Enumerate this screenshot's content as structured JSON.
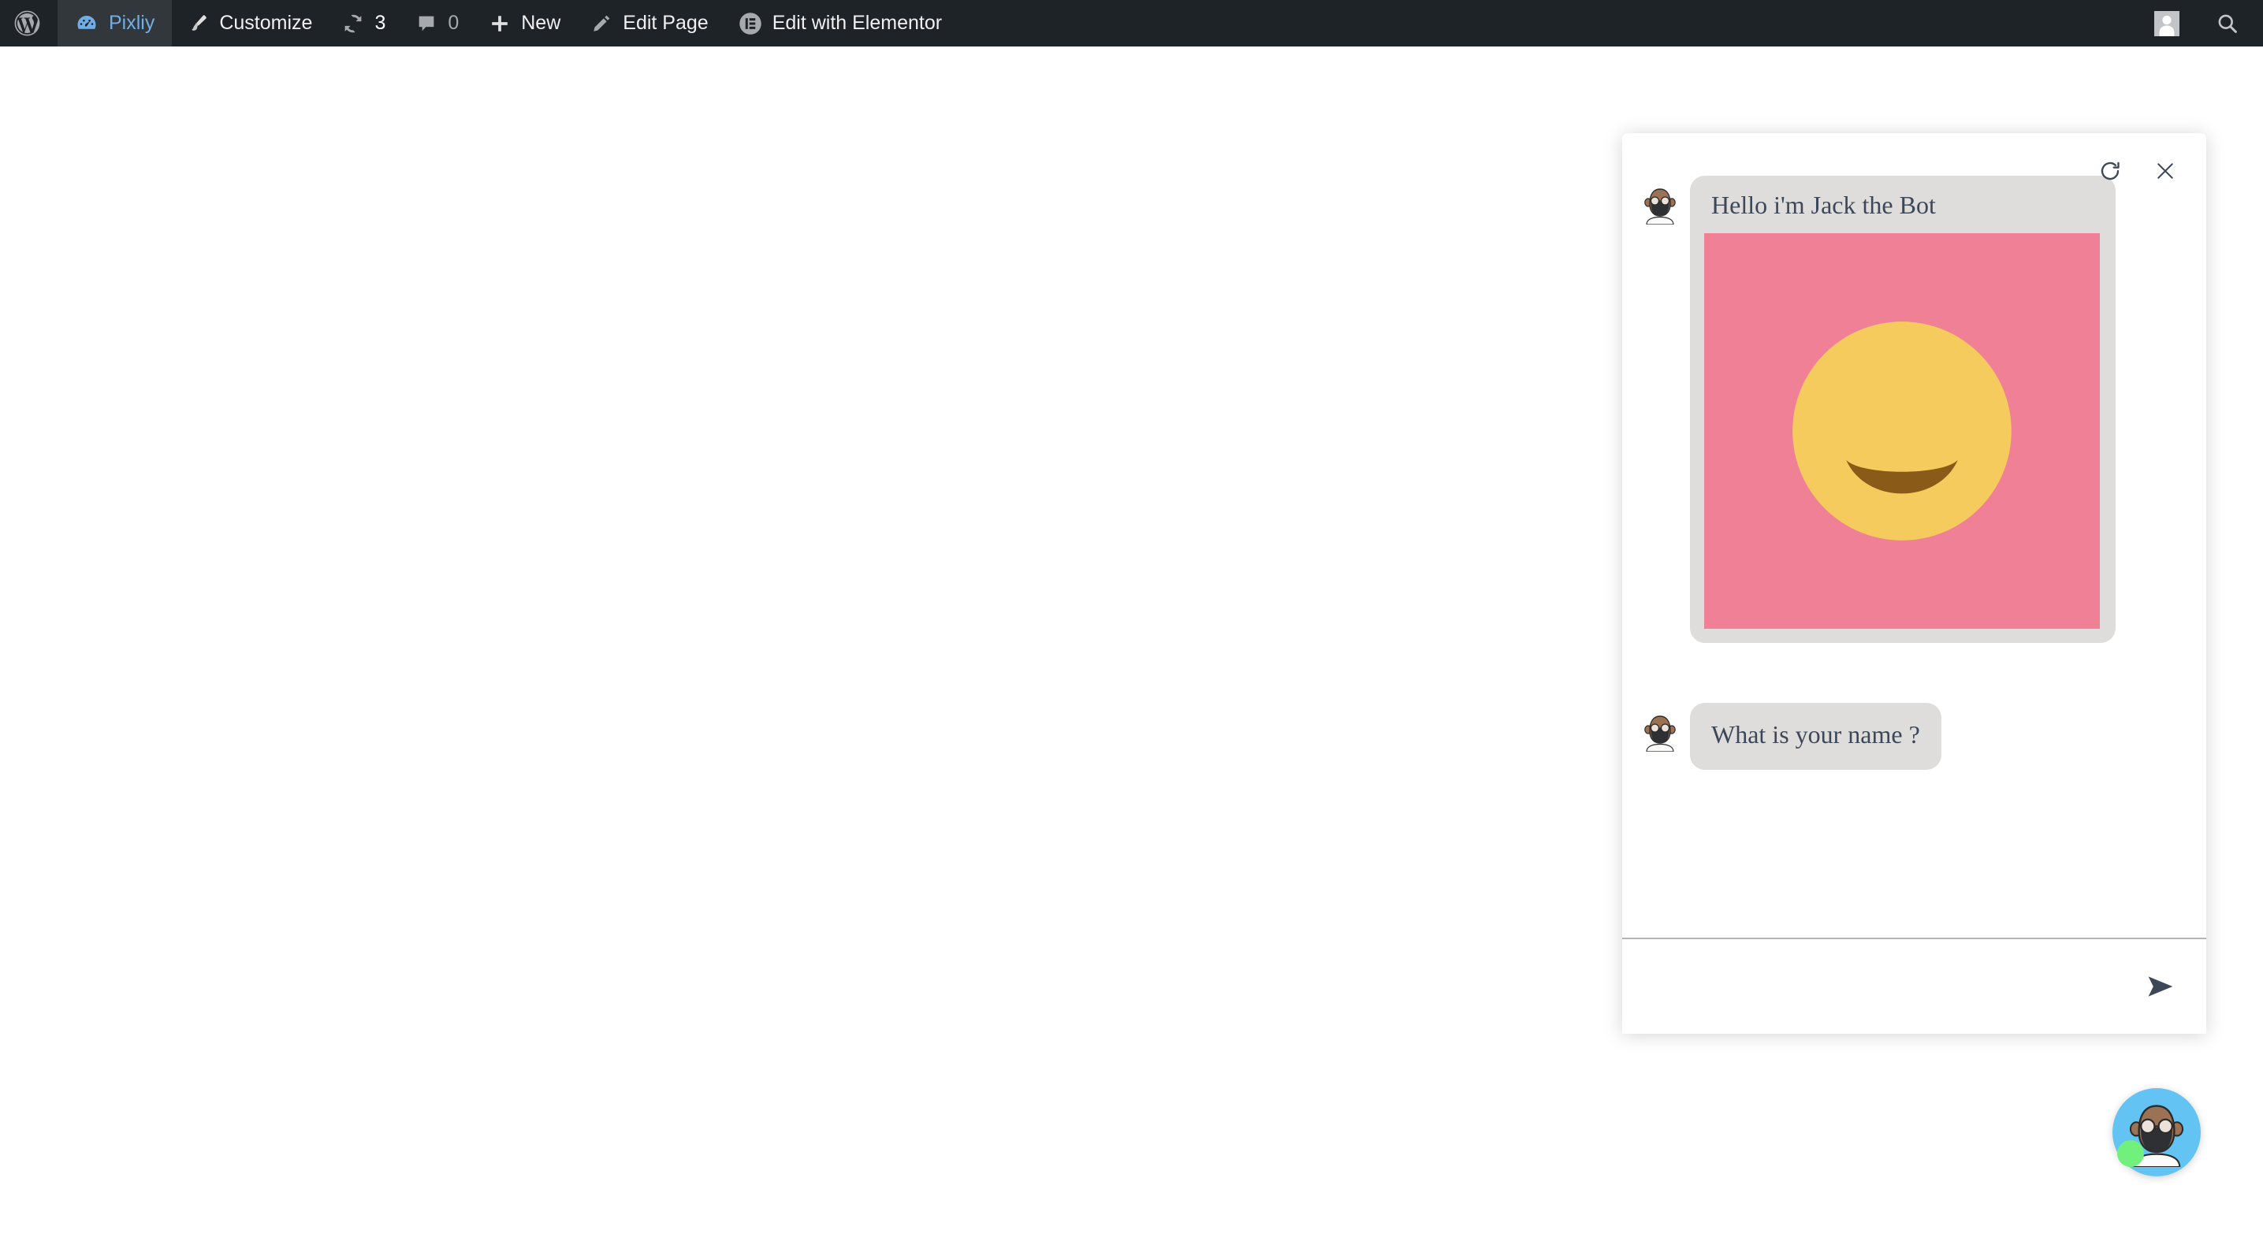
{
  "adminbar": {
    "wp_logo": "wordpress-logo-icon",
    "site_name": "Pixliy",
    "site_icon": "dashboard-speedometer-icon",
    "customize": {
      "label": "Customize",
      "icon": "paintbrush-icon"
    },
    "updates": {
      "count": "3",
      "icon": "update-refresh-icon"
    },
    "comments": {
      "count": "0",
      "icon": "comment-bubble-icon"
    },
    "new": {
      "label": "New",
      "icon": "plus-icon"
    },
    "edit_page": {
      "label": "Edit Page",
      "icon": "pencil-icon"
    },
    "elementor": {
      "label": "Edit with Elementor",
      "icon": "elementor-logo-icon"
    },
    "account": {
      "icon": "user-avatar-icon"
    },
    "search": {
      "icon": "search-icon"
    },
    "colors": {
      "background": "#1d2327",
      "active_background": "#32373c",
      "active_text": "#72aee6",
      "text": "#f0f0f1",
      "muted_text": "#a7aaad"
    }
  },
  "chat": {
    "header": {
      "refresh_icon": "refresh-icon",
      "close_icon": "close-icon"
    },
    "messages": [
      {
        "sender": "bot",
        "avatar": "bot-avatar-icon",
        "text": "Hello i'm Jack the Bot",
        "media": {
          "type": "image",
          "alt": "smiling-face-emoji",
          "background_color": "#ef8095"
        }
      },
      {
        "sender": "bot",
        "avatar": "bot-avatar-icon",
        "text": "What is your name ?"
      }
    ],
    "input": {
      "value": "",
      "placeholder": ""
    },
    "send": {
      "label": "Send",
      "icon": "send-paper-plane-icon"
    },
    "colors": {
      "panel_background": "#ffffff",
      "bubble_background": "#dedddb",
      "bubble_text": "#3c4858",
      "media_background": "#ef8095",
      "emoji_yellow": "#f6cb5e",
      "emoji_brown": "#8a5a18"
    }
  },
  "launcher": {
    "avatar": "bot-avatar-icon",
    "status": "online",
    "colors": {
      "background": "#63c3f2",
      "status": "#71f07e"
    }
  }
}
